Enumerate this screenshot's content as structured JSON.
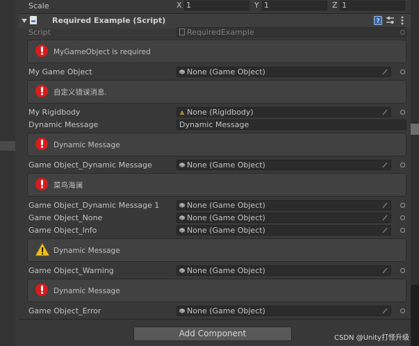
{
  "scale": {
    "label": "Scale",
    "x_label": "X",
    "x": "1",
    "y_label": "Y",
    "y": "1",
    "z_label": "Z",
    "z": "1"
  },
  "component": {
    "title": "Required Example (Script)"
  },
  "script_row": {
    "label": "Script",
    "value": "RequiredExample"
  },
  "rows": [
    {
      "help": "MyGameObject is required",
      "help_type": "error"
    },
    {
      "label": "My Game Object",
      "value": "None (Game Object)",
      "icon": "game-object-icon"
    },
    {
      "help": "自定义错误消息.",
      "help_type": "error"
    },
    {
      "label": "My Rigidbody",
      "value": "None (Rigidbody)",
      "icon": "rigidbody-icon"
    },
    {
      "label": "Dynamic Message",
      "value": "Dynamic Message"
    },
    {
      "help": "Dynamic Message",
      "help_type": "error"
    },
    {
      "label": "Game Object_Dynamic Message",
      "value": "None (Game Object)",
      "icon": "game-object-icon"
    },
    {
      "help": "菜鸟海澜",
      "help_type": "error"
    },
    {
      "label": "Game Object_Dynamic Message 1",
      "value": "None (Game Object)",
      "icon": "game-object-icon"
    },
    {
      "label": "Game Object_None",
      "value": "None (Game Object)",
      "icon": "game-object-icon"
    },
    {
      "label": "Game Object_Info",
      "value": "None (Game Object)",
      "icon": "game-object-icon"
    },
    {
      "help": "Dynamic Message",
      "help_type": "warning"
    },
    {
      "label": "Game Object_Warning",
      "value": "None (Game Object)",
      "icon": "game-object-icon"
    },
    {
      "help": "Dynamic Message",
      "help_type": "error"
    },
    {
      "label": "Game Object_Error",
      "value": "None (Game Object)",
      "icon": "game-object-icon"
    }
  ],
  "footer": {
    "add_component": "Add Component"
  },
  "watermark": "CSDN @Unity打怪升级",
  "colors": {
    "background": "#383838",
    "field": "#2b2b2b",
    "error": "#d81c1c",
    "warning": "#f0c020"
  }
}
